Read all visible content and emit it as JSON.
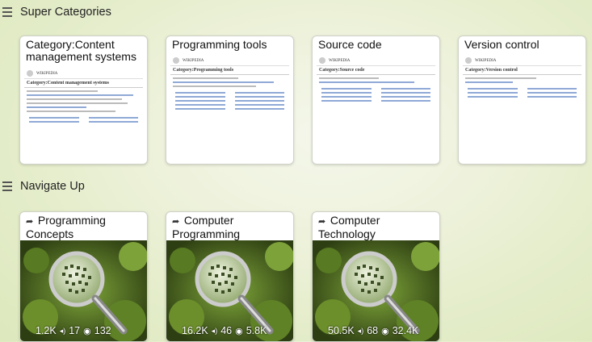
{
  "super_categories": {
    "heading": "Super Categories",
    "cards": [
      {
        "title": "Category:Content management systems",
        "page_title": "Category:Content management systems"
      },
      {
        "title": "Programming tools",
        "page_title": "Category:Programming tools"
      },
      {
        "title": "Source code",
        "page_title": "Category:Source code"
      },
      {
        "title": "Version control",
        "page_title": "Category:Version control"
      }
    ]
  },
  "navigate_up": {
    "heading": "Navigate Up",
    "cards": [
      {
        "title": "Programming Concepts",
        "items": "1.2K",
        "audio": "17",
        "views": "132"
      },
      {
        "title": "Computer Programming",
        "items": "16.2K",
        "audio": "46",
        "views": "5.8K"
      },
      {
        "title": "Computer Technology",
        "items": "50.5K",
        "audio": "68",
        "views": "32.4K"
      }
    ]
  },
  "icons": {
    "section": "list-lines-icon",
    "shared": "share-arrow-icon",
    "items": "grid-icon",
    "audio": "audio-icon",
    "views": "eye-icon"
  }
}
